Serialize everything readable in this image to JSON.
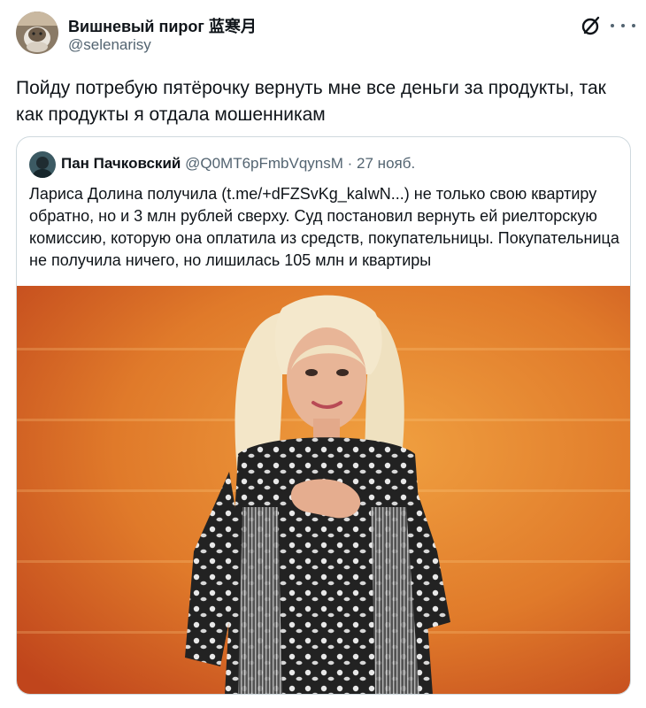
{
  "tweet": {
    "author_name": "Вишневый пирог 蓝寒月",
    "author_handle": "@selenarisy",
    "text": "Пойду потребую пятёрочку вернуть мне все деньги за продукты, так как продукты я отдала мошенникам",
    "icons": [
      "avatar",
      "grok-icon",
      "more-icon"
    ]
  },
  "quote": {
    "author_name": "Пан Пачковский",
    "author_handle": "@Q0MT6pFmbVqynsM",
    "separator": "·",
    "date": "27 нояб.",
    "text": "Лариса Долина получила (t.me/+dFZSvKg_kaIwN...) не только свою квартиру обратно, но и 3 млн рублей сверху. Суд постановил вернуть ей риелторскую комиссию, которую она оплатила из средств, покупательницы. Покупательница не получила ничего, но лишилась 105 млн и квартиры"
  },
  "colors": {
    "text": "#0f1419",
    "secondary": "#536471",
    "border": "#cfd9de",
    "media_bg": "#e0782e"
  }
}
